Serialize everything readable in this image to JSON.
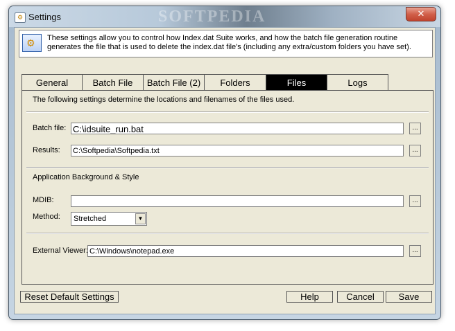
{
  "window": {
    "title": "Settings",
    "close_glyph": "✕",
    "watermark": "SOFTPEDIA"
  },
  "info": {
    "text": "These settings allow you to control how Index.dat Suite works, and how the batch file generation routine generates the file that is used to delete the index.dat file's (including any extra/custom folders you have set).",
    "icon": "gear-icon"
  },
  "tabs": [
    "General",
    "Batch File",
    "Batch File (2)",
    "Folders",
    "Files",
    "Logs"
  ],
  "active_tab": "Files",
  "files": {
    "description": "The following settings determine the locations and filenames of the files used.",
    "batch_label": "Batch file:",
    "batch_value": "C:\\idsuite_run.bat",
    "results_label": "Results:",
    "results_value": "C:\\Softpedia\\Softpedia.txt",
    "section_style": "Application Background & Style",
    "mdib_label": "MDIB:",
    "mdib_value": "",
    "method_label": "Method:",
    "method_value": "Stretched",
    "viewer_label": "External Viewer:",
    "viewer_value": "C:\\Windows\\notepad.exe",
    "browse_glyph": "..."
  },
  "buttons": {
    "reset": "Reset Default Settings",
    "help": "Help",
    "cancel": "Cancel",
    "save": "Save"
  }
}
